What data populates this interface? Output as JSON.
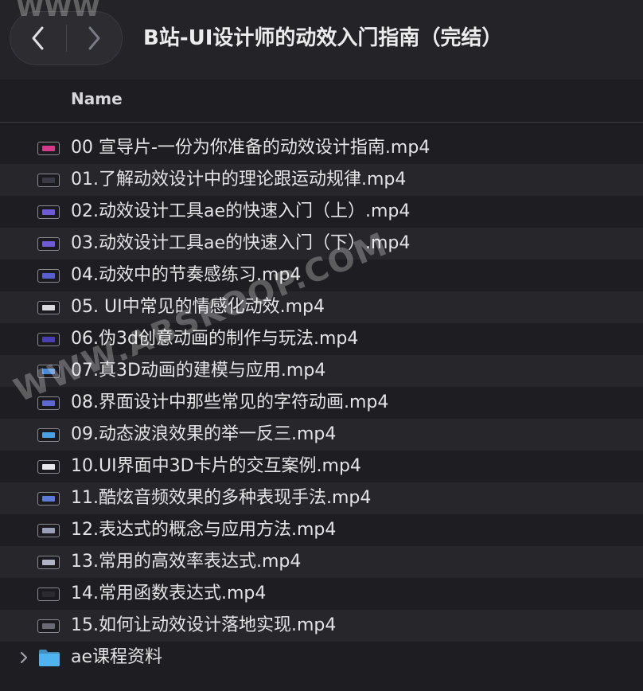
{
  "window": {
    "title": "B站-UI设计师的动效入门指南（完结）"
  },
  "toolbar": {
    "back_icon": "chevron-left-icon",
    "forward_icon": "chevron-right-icon"
  },
  "columns": {
    "name": "Name"
  },
  "files": [
    {
      "label": "00 宣导片-一份为你准备的动效设计指南.mp4",
      "icon": "video-thumbnail-icon",
      "thumb_color": "#d13b8a"
    },
    {
      "label": "01.了解动效设计中的理论跟运动规律.mp4",
      "icon": "video-thumbnail-icon",
      "thumb_color": "#3a3a44"
    },
    {
      "label": "02.动效设计工具ae的快速入门（上）.mp4",
      "icon": "video-thumbnail-icon",
      "thumb_color": "#6f5bd6"
    },
    {
      "label": "03.动效设计工具ae的快速入门（下）.mp4",
      "icon": "video-thumbnail-icon",
      "thumb_color": "#6f5bd6"
    },
    {
      "label": "04.动效中的节奏感练习.mp4",
      "icon": "video-thumbnail-icon",
      "thumb_color": "#5a5fd0"
    },
    {
      "label": "05. UI中常见的情感化动效.mp4",
      "icon": "video-thumbnail-icon",
      "thumb_color": "#d9d9de"
    },
    {
      "label": "06.伪3d创意动画的制作与玩法.mp4",
      "icon": "video-thumbnail-icon",
      "thumb_color": "#4a3fb0"
    },
    {
      "label": "07.真3D动画的建模与应用.mp4",
      "icon": "video-thumbnail-icon",
      "thumb_color": "#4a8ad6"
    },
    {
      "label": "08.界面设计中那些常见的字符动画.mp4",
      "icon": "video-thumbnail-icon",
      "thumb_color": "#5a6ad0"
    },
    {
      "label": "09.动态波浪效果的举一反三.mp4",
      "icon": "video-thumbnail-icon",
      "thumb_color": "#4aa0e0"
    },
    {
      "label": "10.UI界面中3D卡片的交互案例.mp4",
      "icon": "video-thumbnail-icon",
      "thumb_color": "#e8e8ec"
    },
    {
      "label": "11.酷炫音频效果的多种表现手法.mp4",
      "icon": "video-thumbnail-icon",
      "thumb_color": "#5b7bd6"
    },
    {
      "label": "12.表达式的概念与应用方法.mp4",
      "icon": "video-thumbnail-icon",
      "thumb_color": "#9aa0b8"
    },
    {
      "label": "13.常用的高效率表达式.mp4",
      "icon": "video-thumbnail-icon",
      "thumb_color": "#b0b4c4"
    },
    {
      "label": "14.常用函数表达式.mp4",
      "icon": "video-thumbnail-icon",
      "thumb_color": "#2a2a30"
    },
    {
      "label": "15.如何让动效设计落地实现.mp4",
      "icon": "video-thumbnail-icon",
      "thumb_color": "#6a6a74"
    }
  ],
  "folder": {
    "label": "ae课程资料",
    "icon": "folder-icon",
    "disclosure_icon": "chevron-right-icon",
    "color": "#4fb3f0"
  },
  "watermark": {
    "text": "WWW.ABSKOOP.COM",
    "top_text": "WWW"
  }
}
